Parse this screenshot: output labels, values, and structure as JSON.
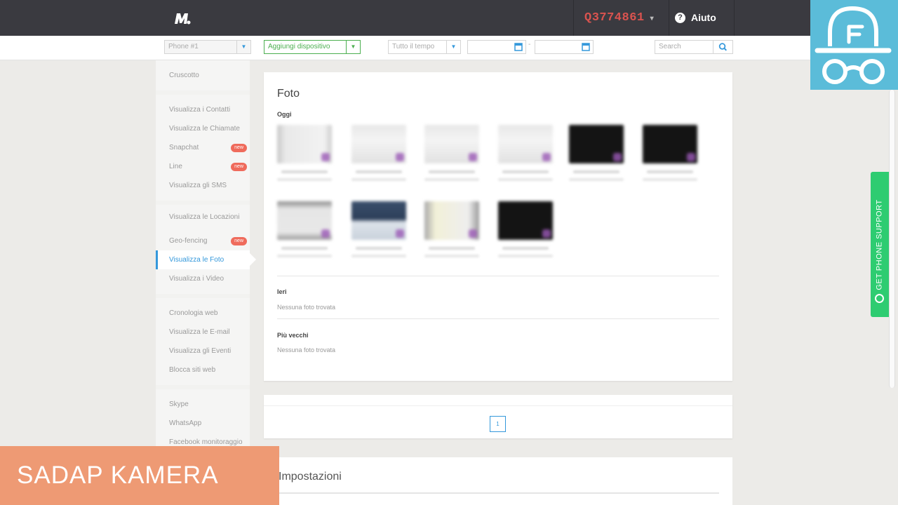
{
  "header": {
    "account_id": "Q3774861",
    "account_caret": "▾",
    "help_label": "Aiuto",
    "help_icon": "?"
  },
  "toolbar": {
    "phone_select": "Phone #1",
    "add_device": "Aggiungi dispositivo",
    "time_select": "Tutto il tempo",
    "date_from": "",
    "date_to": "",
    "date_sep": "-",
    "search_placeholder": "Search"
  },
  "sidebar": {
    "groups": [
      [
        {
          "label": "Cruscotto"
        }
      ],
      [
        {
          "label": "Visualizza i Contatti"
        },
        {
          "label": "Visualizza le Chiamate"
        },
        {
          "label": "Snapchat",
          "badge": "new"
        },
        {
          "label": "Line",
          "badge": "new"
        },
        {
          "label": "Visualizza gli SMS"
        }
      ],
      [
        {
          "label": "Visualizza le Locazioni"
        },
        {
          "label": "Geo-fencing",
          "badge": "new"
        },
        {
          "label": "Visualizza le Foto",
          "active": true
        },
        {
          "label": "Visualizza i Video"
        }
      ],
      [
        {
          "label": "Cronologia web"
        },
        {
          "label": "Visualizza le E-mail"
        },
        {
          "label": "Visualizza gli Eventi"
        },
        {
          "label": "Blocca siti web"
        }
      ],
      [
        {
          "label": "Skype"
        },
        {
          "label": "WhatsApp"
        },
        {
          "label": "Facebook monitoraggio"
        }
      ]
    ]
  },
  "main": {
    "title": "Foto",
    "today_label": "Oggi",
    "yesterday_label": "Ieri",
    "yesterday_empty": "Nessuna foto trovata",
    "older_label": "Più vecchi",
    "older_empty": "Nessuna foto trovata"
  },
  "pagination": {
    "current": "1"
  },
  "settings": {
    "title": "Impostazioni"
  },
  "support_tab": {
    "label": "GET PHONE SUPPORT"
  },
  "overlay": {
    "caption": "SADAP KAMERA"
  },
  "colors": {
    "topbar": "#3a3a40",
    "accent_blue": "#3498db",
    "account_red": "#d9534f",
    "add_green": "#4caf50",
    "support_green": "#2ecc71",
    "badge_red": "#ef6b5c",
    "incognito_bg": "#5bbcd9",
    "caption_bg": "#ee9a74"
  },
  "icons": [
    "mspy-logo-icon",
    "help-icon",
    "calendar-icon",
    "search-icon",
    "headset-icon",
    "incognito-icon"
  ]
}
